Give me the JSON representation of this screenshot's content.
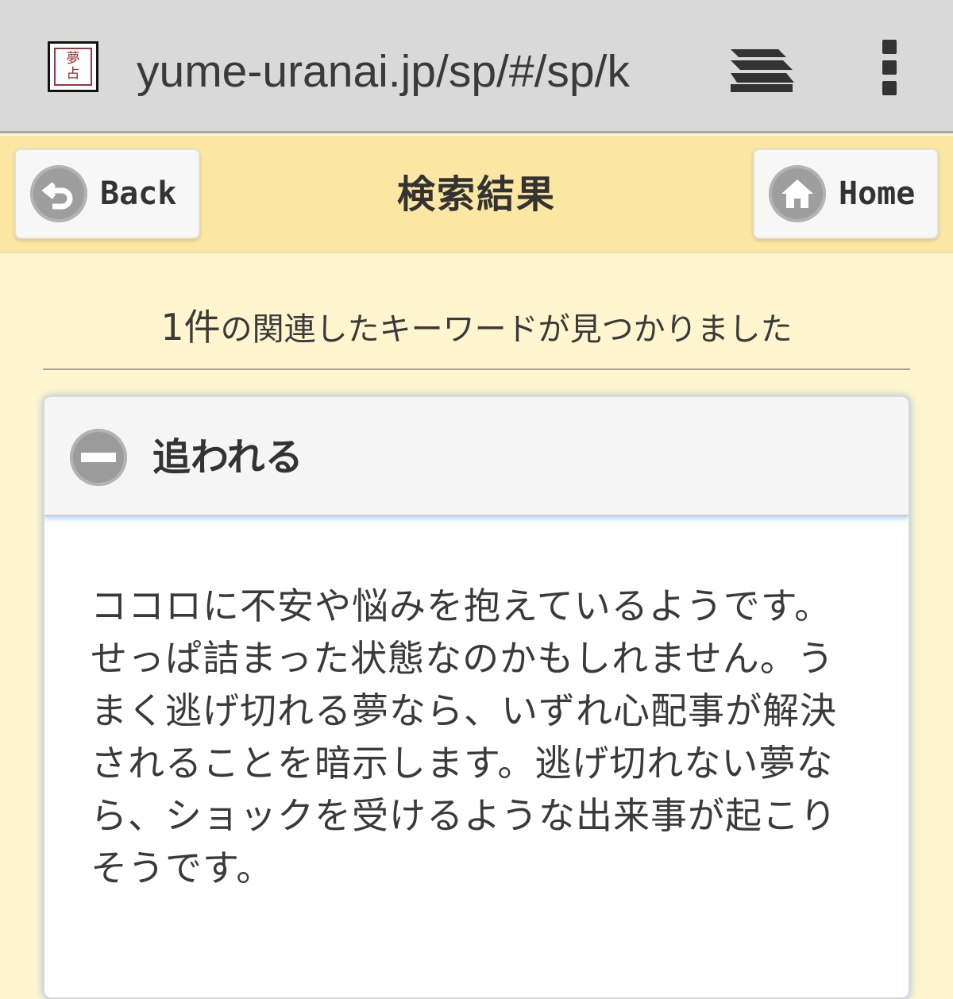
{
  "browser": {
    "favicon_text_top": "夢",
    "favicon_text_bottom": "占",
    "url": "yume-uranai.jp/sp/#/sp/k",
    "tabs_icon": "tabs-icon",
    "menu_icon": "overflow-menu-icon"
  },
  "header": {
    "back_label": "Back",
    "title": "検索結果",
    "home_label": "Home",
    "back_icon": "back-arrow-icon",
    "home_icon": "home-icon",
    "color": "#fbe6a2"
  },
  "results": {
    "count": "1件",
    "count_suffix": "の関連したキーワードが見つかりました"
  },
  "entry": {
    "keyword": "追われる",
    "state_icon": "collapse-minus-icon",
    "description": "ココロに不安や悩みを抱えているようです。せっぱ詰まった状態なのかもしれません。うまく逃げ切れる夢なら、いずれ心配事が解決されることを暗示します。逃げ切れない夢なら、ショックを受けるような出来事が起こりそうです。"
  }
}
